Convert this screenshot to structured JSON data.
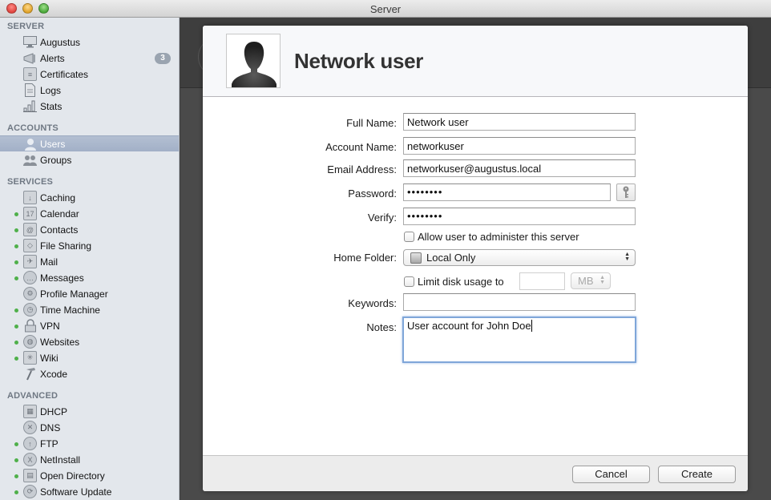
{
  "window": {
    "title": "Server",
    "buttons": [
      "close",
      "minimize",
      "zoom"
    ]
  },
  "sidebar": {
    "sections": [
      {
        "header": "SERVER",
        "items": [
          {
            "label": "Augustus",
            "icon": "monitor-icon",
            "status": false
          },
          {
            "label": "Alerts",
            "icon": "megaphone-icon",
            "status": false,
            "badge": "3"
          },
          {
            "label": "Certificates",
            "icon": "certificate-icon",
            "status": false
          },
          {
            "label": "Logs",
            "icon": "document-icon",
            "status": false
          },
          {
            "label": "Stats",
            "icon": "bar-chart-icon",
            "status": false
          }
        ]
      },
      {
        "header": "ACCOUNTS",
        "items": [
          {
            "label": "Users",
            "icon": "user-icon",
            "status": false,
            "selected": true
          },
          {
            "label": "Groups",
            "icon": "group-icon",
            "status": false
          }
        ]
      },
      {
        "header": "SERVICES",
        "items": [
          {
            "label": "Caching",
            "icon": "caching-icon",
            "status": false
          },
          {
            "label": "Calendar",
            "icon": "calendar-icon",
            "status": true,
            "icon_text": "17"
          },
          {
            "label": "Contacts",
            "icon": "contacts-icon",
            "status": true
          },
          {
            "label": "File Sharing",
            "icon": "file-sharing-icon",
            "status": true
          },
          {
            "label": "Mail",
            "icon": "mail-icon",
            "status": true
          },
          {
            "label": "Messages",
            "icon": "messages-icon",
            "status": true
          },
          {
            "label": "Profile Manager",
            "icon": "profile-manager-icon",
            "status": false
          },
          {
            "label": "Time Machine",
            "icon": "time-machine-icon",
            "status": true
          },
          {
            "label": "VPN",
            "icon": "vpn-lock-icon",
            "status": true
          },
          {
            "label": "Websites",
            "icon": "globe-icon",
            "status": true
          },
          {
            "label": "Wiki",
            "icon": "wiki-icon",
            "status": true
          },
          {
            "label": "Xcode",
            "icon": "hammer-icon",
            "status": false
          }
        ]
      },
      {
        "header": "ADVANCED",
        "items": [
          {
            "label": "DHCP",
            "icon": "dhcp-icon",
            "status": false
          },
          {
            "label": "DNS",
            "icon": "dns-icon",
            "status": false
          },
          {
            "label": "FTP",
            "icon": "ftp-icon",
            "status": true
          },
          {
            "label": "NetInstall",
            "icon": "netinstall-icon",
            "status": true
          },
          {
            "label": "Open Directory",
            "icon": "open-directory-icon",
            "status": true
          },
          {
            "label": "Software Update",
            "icon": "software-update-icon",
            "status": true
          }
        ]
      }
    ]
  },
  "sheet": {
    "title": "Network user",
    "avatar_icon": "user-silhouette-icon",
    "form": {
      "full_name": {
        "label": "Full Name:",
        "value": "Network user"
      },
      "account_name": {
        "label": "Account Name:",
        "value": "networkuser"
      },
      "email": {
        "label": "Email Address:",
        "value": "networkuser@augustus.local"
      },
      "password": {
        "label": "Password:",
        "value": "••••••••"
      },
      "verify": {
        "label": "Verify:",
        "value": "••••••••"
      },
      "allow_admin": {
        "label": "Allow user to administer this server",
        "checked": false
      },
      "home_folder": {
        "label": "Home Folder:",
        "value": "Local Only"
      },
      "limit_disk": {
        "label": "Limit disk usage to",
        "checked": false,
        "value": "",
        "unit": "MB"
      },
      "keywords": {
        "label": "Keywords:",
        "value": ""
      },
      "notes": {
        "label": "Notes:",
        "value": "User account for John Doe"
      }
    },
    "buttons": {
      "cancel": "Cancel",
      "create": "Create"
    }
  },
  "colors": {
    "status_on": "#4fb04a",
    "selection": "#a9b6cc",
    "focus_ring": "#7fa6d9"
  }
}
